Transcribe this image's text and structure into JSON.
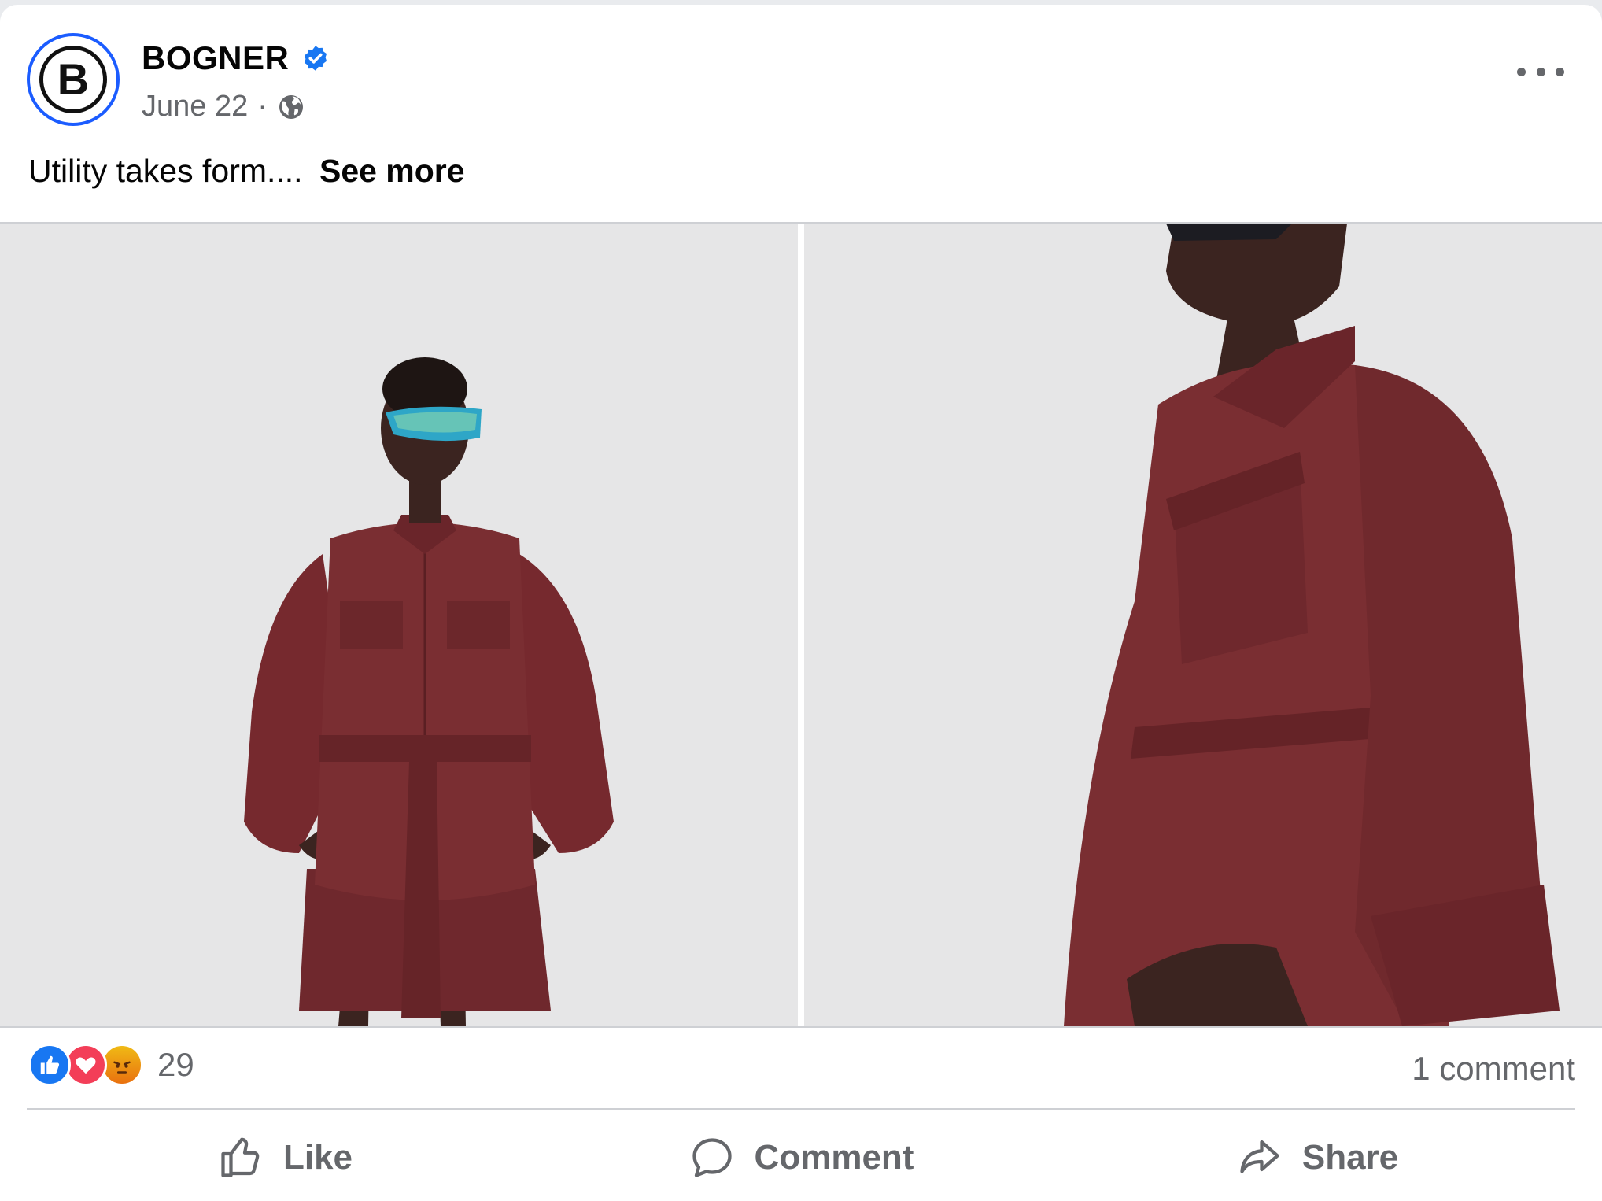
{
  "post": {
    "page_name": "BOGNER",
    "avatar_letter": "B",
    "date": "June 22",
    "meta_separator": "·",
    "caption": "Utility takes form....",
    "see_more": "See more"
  },
  "reactions": {
    "count": "29",
    "types": [
      "like",
      "love",
      "angry"
    ]
  },
  "comments": {
    "count_label": "1 comment"
  },
  "actions": {
    "like": "Like",
    "comment": "Comment",
    "share": "Share"
  },
  "colors": {
    "accent": "#1877f2",
    "avatar_ring": "#1b5cff",
    "muted_text": "#65676b",
    "garment": "#7a2e32"
  },
  "icons": [
    "verified-badge-icon",
    "globe-icon",
    "more-options-icon",
    "like-reaction-icon",
    "love-reaction-icon",
    "angry-reaction-icon",
    "thumbs-up-icon",
    "comment-icon",
    "share-icon"
  ]
}
